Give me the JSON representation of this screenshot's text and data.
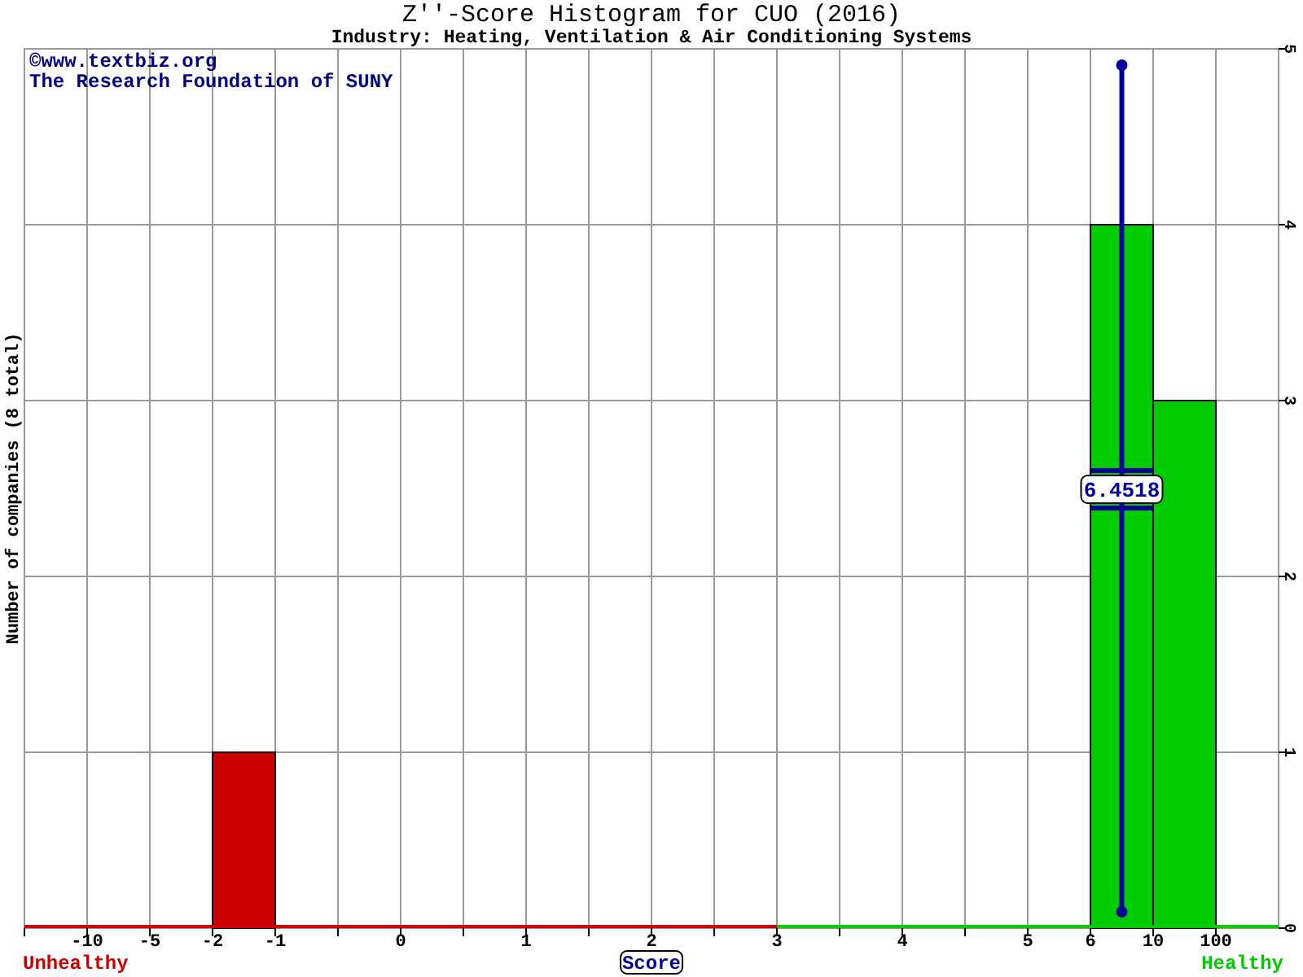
{
  "chart": {
    "copyright": [
      "©www.textbiz.org",
      "The Research Foundation of SUNY"
    ],
    "chart_data": {
      "type": "bar",
      "title": "Z''-Score Histogram for CUO (2016)",
      "subtitle": "Industry: Heating, Ventilation & Air Conditioning Systems",
      "xlabel": "Score",
      "ylabel": "Number of companies (8 total)",
      "categories": [
        null,
        "-10",
        "-5",
        "-2",
        "-1",
        null,
        "0",
        null,
        "1",
        null,
        "2",
        null,
        "3",
        null,
        "4",
        null,
        "5",
        "6",
        "10",
        "100"
      ],
      "grid": true,
      "series": [
        {
          "name": "Unhealthy",
          "color": "#cc0000",
          "values": [
            0,
            0,
            0,
            1,
            0,
            0,
            0,
            0,
            0,
            0,
            0,
            0,
            null,
            null,
            null,
            null,
            null,
            null,
            null,
            null
          ]
        },
        {
          "name": "Healthy",
          "color": "#00cc00",
          "values": [
            null,
            null,
            null,
            null,
            null,
            null,
            null,
            null,
            null,
            null,
            null,
            null,
            0,
            0,
            0,
            0,
            0,
            4,
            3,
            0
          ]
        }
      ],
      "ylim": [
        0,
        5
      ],
      "yticks": [
        0,
        1,
        2,
        3,
        4,
        5
      ],
      "annotations": [
        "6.4518"
      ]
    }
  }
}
